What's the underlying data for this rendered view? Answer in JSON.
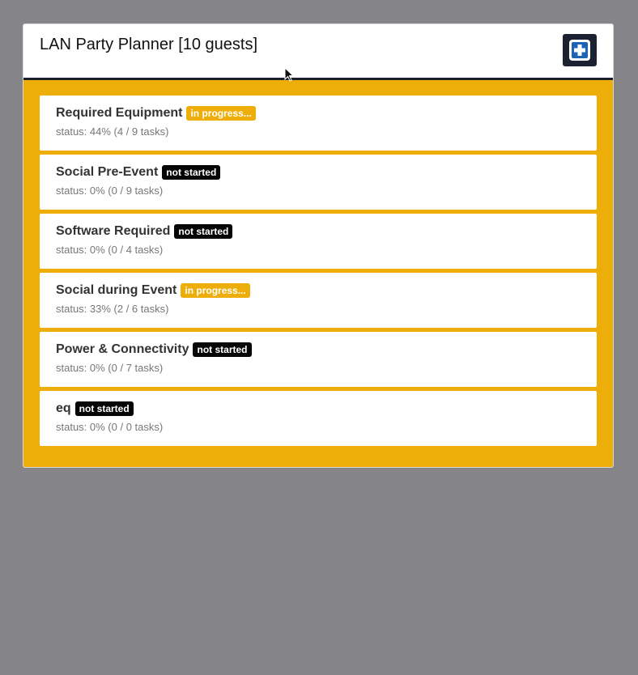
{
  "header": {
    "title": "LAN Party Planner [10 guests]",
    "add_icon": "plus-square-icon"
  },
  "colors": {
    "background": "#858589",
    "card_accent": "#eeae0a",
    "add_button": "#1b2130",
    "badge_in_progress": "#eeae0a",
    "badge_not_started": "#050505"
  },
  "items": [
    {
      "title": "Required Equipment",
      "badge": "in progress...",
      "state": "in-progress",
      "status": "status: 44% (4 / 9 tasks)"
    },
    {
      "title": "Social Pre-Event",
      "badge": "not started",
      "state": "not-started",
      "status": "status: 0% (0 / 9 tasks)"
    },
    {
      "title": "Software Required",
      "badge": "not started",
      "state": "not-started",
      "status": "status: 0% (0 / 4 tasks)"
    },
    {
      "title": "Social during Event",
      "badge": "in progress...",
      "state": "in-progress",
      "status": "status: 33% (2 / 6 tasks)"
    },
    {
      "title": "Power & Connectivity",
      "badge": "not started",
      "state": "not-started",
      "status": "status: 0% (0 / 7 tasks)"
    },
    {
      "title": "eq",
      "badge": "not started",
      "state": "not-started",
      "status": "status: 0% (0 / 0 tasks)"
    }
  ]
}
